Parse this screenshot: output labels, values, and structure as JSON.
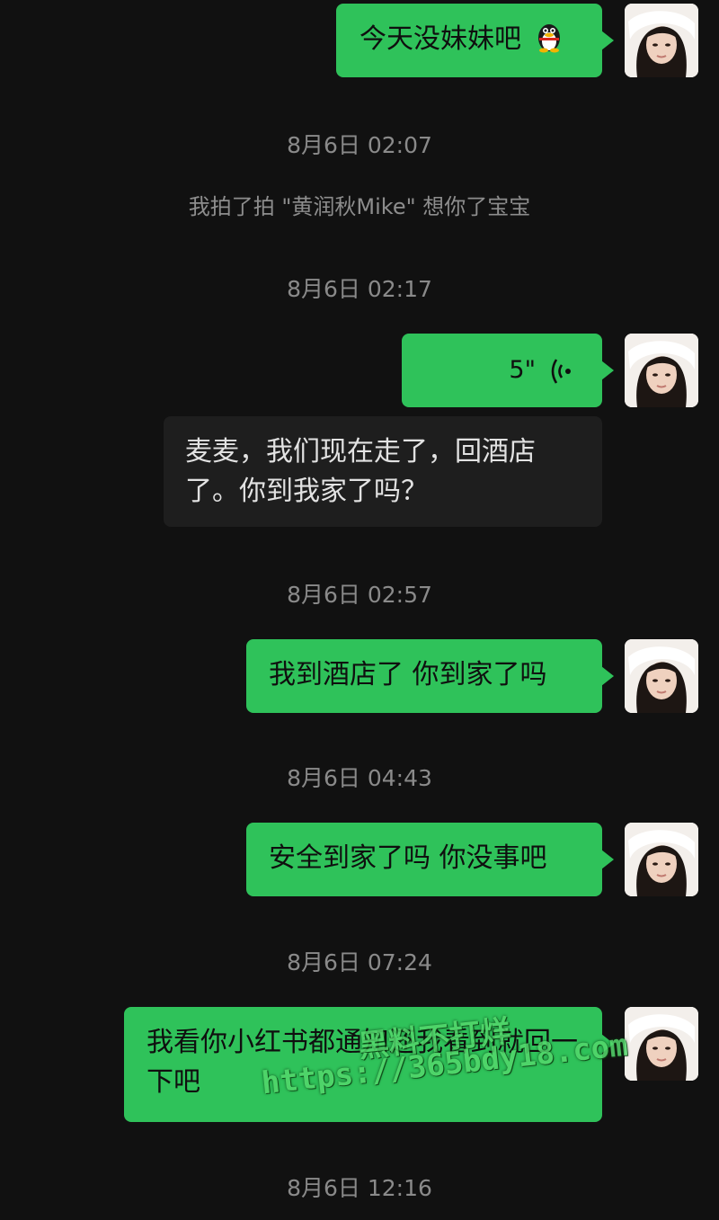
{
  "messages": [
    {
      "text": "今天没妹妹吧"
    },
    {
      "timestamp": "8月6日 02:07"
    },
    {
      "system": "我拍了拍 \"黄润秋Mike\" 想你了宝宝"
    },
    {
      "timestamp": "8月6日 02:17"
    },
    {
      "voice_duration": "5\""
    },
    {
      "text": "麦麦，我们现在走了，回酒店了。你到我家了吗？"
    },
    {
      "timestamp": "8月6日 02:57"
    },
    {
      "text": "我到酒店了 你到家了吗"
    },
    {
      "timestamp": "8月6日 04:43"
    },
    {
      "text": "安全到家了吗 你没事吧"
    },
    {
      "timestamp": "8月6日 07:24"
    },
    {
      "text": "我看你小红书都通知还我看到就回一下吧"
    },
    {
      "timestamp": "8月6日 12:16"
    }
  ],
  "watermark": {
    "line1": "黑料不打烊",
    "line2": "https://365bdy18.com"
  },
  "colors": {
    "background": "#111111",
    "outgoing_bubble": "#2fc25a",
    "incoming_bubble": "#1e1e1e",
    "timestamp_text": "#8a8a8a"
  },
  "icons": [
    "qq-penguin-emoji-icon",
    "voice-wave-icon",
    "avatar"
  ]
}
